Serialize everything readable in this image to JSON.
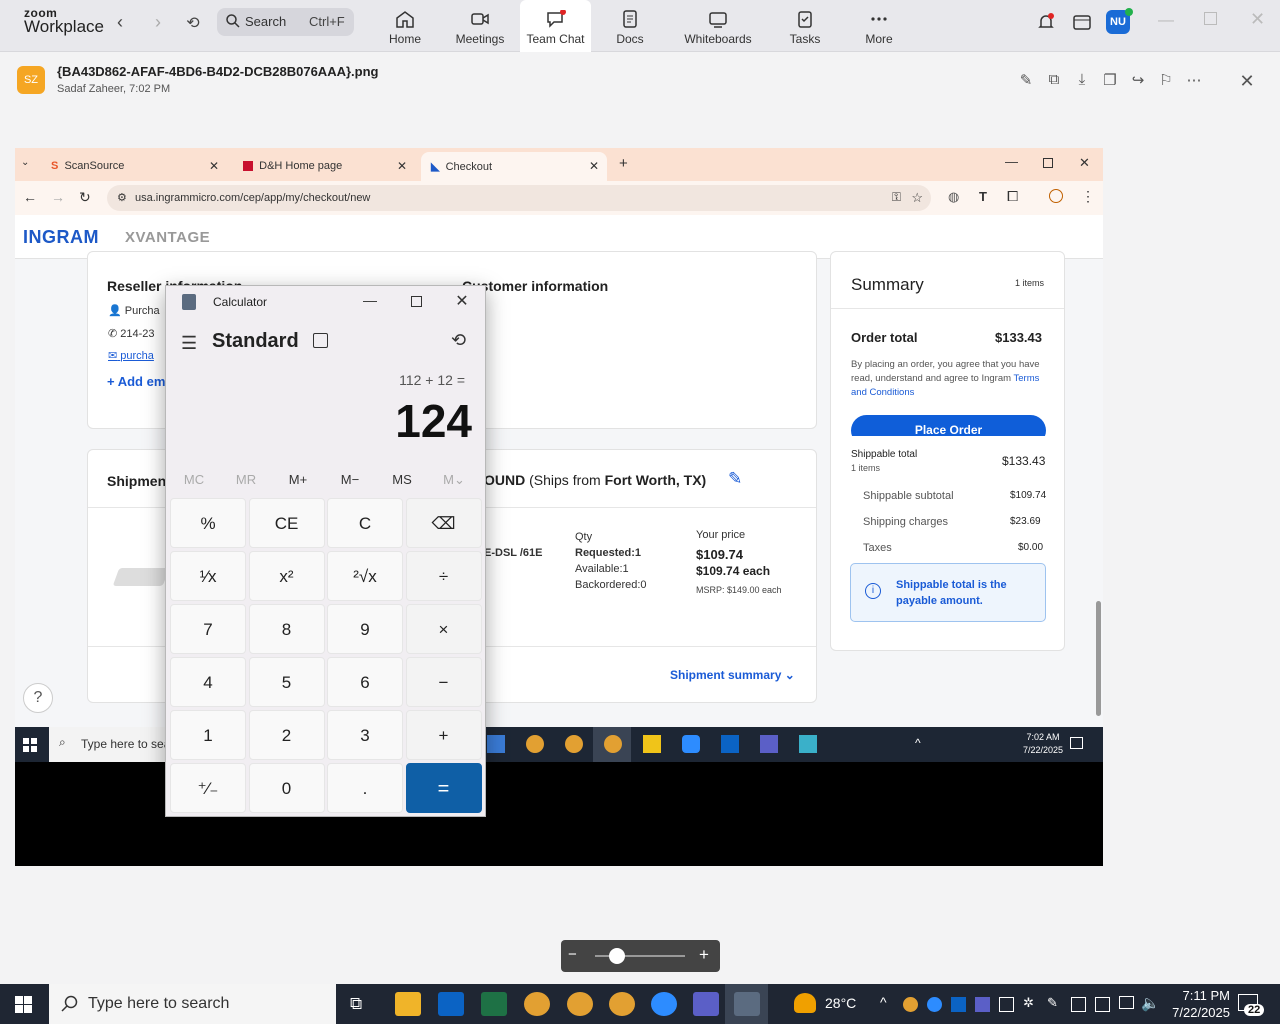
{
  "zoom": {
    "logo_top": "zoom",
    "logo_bottom": "Workplace",
    "search_label": "Search",
    "search_shortcut": "Ctrl+F",
    "tabs": [
      {
        "label": "Home"
      },
      {
        "label": "Meetings"
      },
      {
        "label": "Team Chat"
      },
      {
        "label": "Docs"
      },
      {
        "label": "Whiteboards"
      },
      {
        "label": "Tasks"
      },
      {
        "label": "More"
      }
    ],
    "user_initials": "NU"
  },
  "doc": {
    "avatar": "SZ",
    "filename": "{BA43D862-AFAF-4BD6-B4D2-DCB28B076AAA}.png",
    "meta": "Sadaf Zaheer, 7:02 PM"
  },
  "browser": {
    "tabs": [
      {
        "label": "ScanSource"
      },
      {
        "label": "D&H Home page"
      },
      {
        "label": "Checkout"
      }
    ],
    "url": "usa.ingrammicro.com/cep/app/my/checkout/new"
  },
  "site": {
    "logo": "INGRAM",
    "logo_sub": "XVANTAGE",
    "reseller_title": "Reseller information",
    "reseller_purchaser": "Purcha",
    "reseller_phone": "214-23",
    "reseller_email": "purcha",
    "add_email": "+ Add em",
    "customer_title": "Customer information",
    "shipment_title": "Shipmen",
    "shipping_method": "OUND",
    "ships_from_prefix": "(Ships from",
    "ships_from": "Fort Worth, TX)",
    "product_sku": "E-DSL /61E",
    "qty_label": "Qty",
    "qty_requested": "Requested:1",
    "qty_available": "Available:1",
    "qty_backordered": "Backordered:0",
    "price_label": "Your price",
    "price": "$109.74",
    "price_each": "$109.74 each",
    "msrp": "MSRP: $149.00 each",
    "shipment_summary": "Shipment summary",
    "summary_title": "Summary",
    "summary_items": "1 items",
    "order_total_label": "Order total",
    "order_total": "$133.43",
    "agree_text": "By placing an order, you agree that you have read, understand and agree to Ingram",
    "terms_link": "Terms and Conditions",
    "place_order": "Place Order",
    "shippable_total_label": "Shippable total",
    "shippable_items": "1 items",
    "shippable_total": "$133.43",
    "subtotal_label": "Shippable subtotal",
    "subtotal": "$109.74",
    "shipping_label": "Shipping charges",
    "shipping": "$23.69",
    "taxes_label": "Taxes",
    "taxes": "$0.00",
    "info_text": "Shippable total is the payable amount."
  },
  "inner_taskbar": {
    "search": "Type here to sea",
    "time": "7:02 AM",
    "date": "7/22/2025"
  },
  "calculator": {
    "title": "Calculator",
    "mode": "Standard",
    "expression": "112 + 12 =",
    "result": "124",
    "memory": [
      "MC",
      "MR",
      "M+",
      "M−",
      "MS",
      "M⌄"
    ],
    "keys": [
      [
        "%",
        "CE",
        "C",
        "⌫"
      ],
      [
        "¹⁄x",
        "x²",
        "²√x",
        "÷"
      ],
      [
        "7",
        "8",
        "9",
        "×"
      ],
      [
        "4",
        "5",
        "6",
        "−"
      ],
      [
        "1",
        "2",
        "3",
        "+"
      ],
      [
        "⁺⁄₋",
        "0",
        ".",
        "="
      ]
    ]
  },
  "taskbar": {
    "search": "Type here to search",
    "weather": "28°C",
    "time": "7:11 PM",
    "date": "7/22/2025",
    "notifications": "22"
  }
}
